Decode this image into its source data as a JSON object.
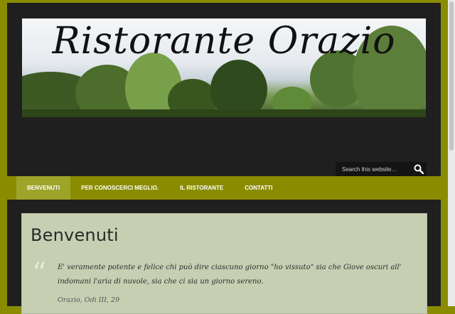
{
  "site": {
    "title": "Ristorante Orazio"
  },
  "search": {
    "placeholder": "Search this website…",
    "icon": "search-icon"
  },
  "nav": {
    "items": [
      {
        "label": "BENVENUTI",
        "active": true
      },
      {
        "label": "PER CONOSCERCI MEGLIO.",
        "active": false
      },
      {
        "label": "IL RISTORANTE",
        "active": false
      },
      {
        "label": "CONTATTI",
        "active": false
      }
    ]
  },
  "content": {
    "title": "Benvenuti",
    "quote_mark": "“",
    "quote": "E' veramente potente e felice chi può dire ciascuno giorno \"ho vissuto\" sia che Giove oscuri all' indomani l'aria di nuvole, sia che ci sia un giorno sereno.",
    "cite": "Orazio, Odi III, 29"
  },
  "colors": {
    "accent": "#8a8c00",
    "page_background": "#1f1f1f",
    "content_background": "#c6cfb2"
  }
}
